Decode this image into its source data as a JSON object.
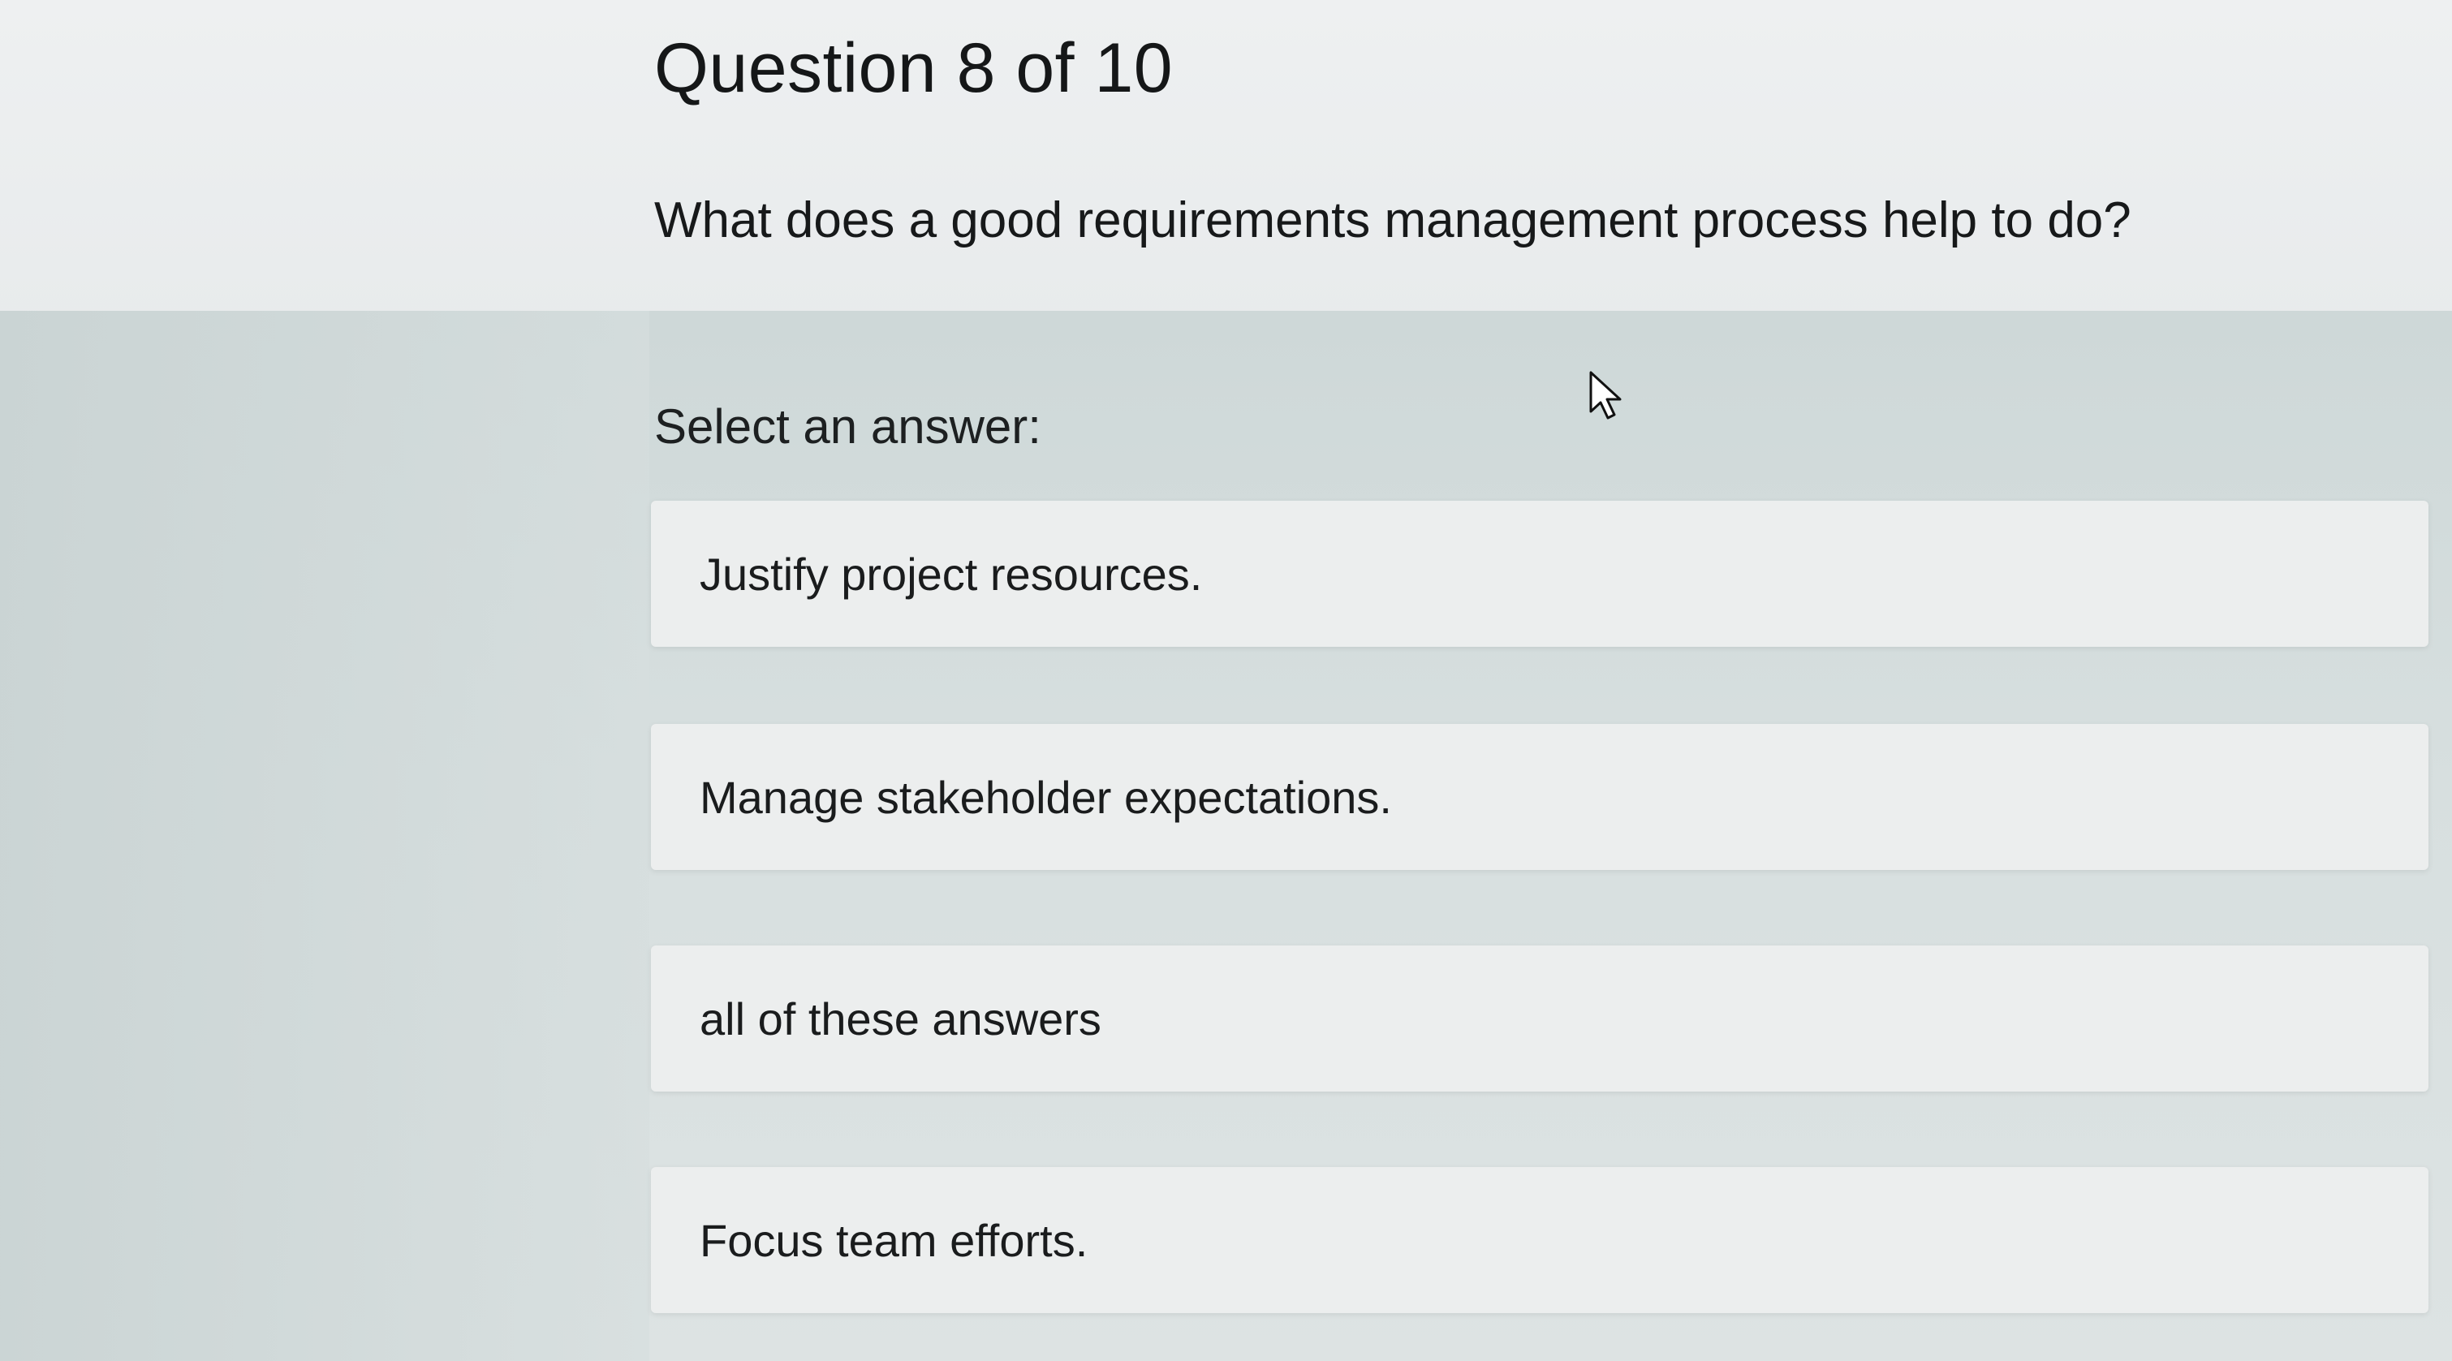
{
  "question": {
    "title": "Question 8 of 10",
    "text": "What does a good requirements management process help to do?"
  },
  "answers": {
    "prompt": "Select an answer:",
    "options": [
      "Justify project resources.",
      "Manage stakeholder expectations.",
      "all of these answers",
      "Focus team efforts."
    ]
  },
  "colors": {
    "page_background": "#dfe3e3",
    "question_area": "#eef0f1",
    "option_background": "#eceeee",
    "text": "#1b1d1e"
  },
  "icons": {
    "cursor": "mouse-pointer-icon"
  }
}
